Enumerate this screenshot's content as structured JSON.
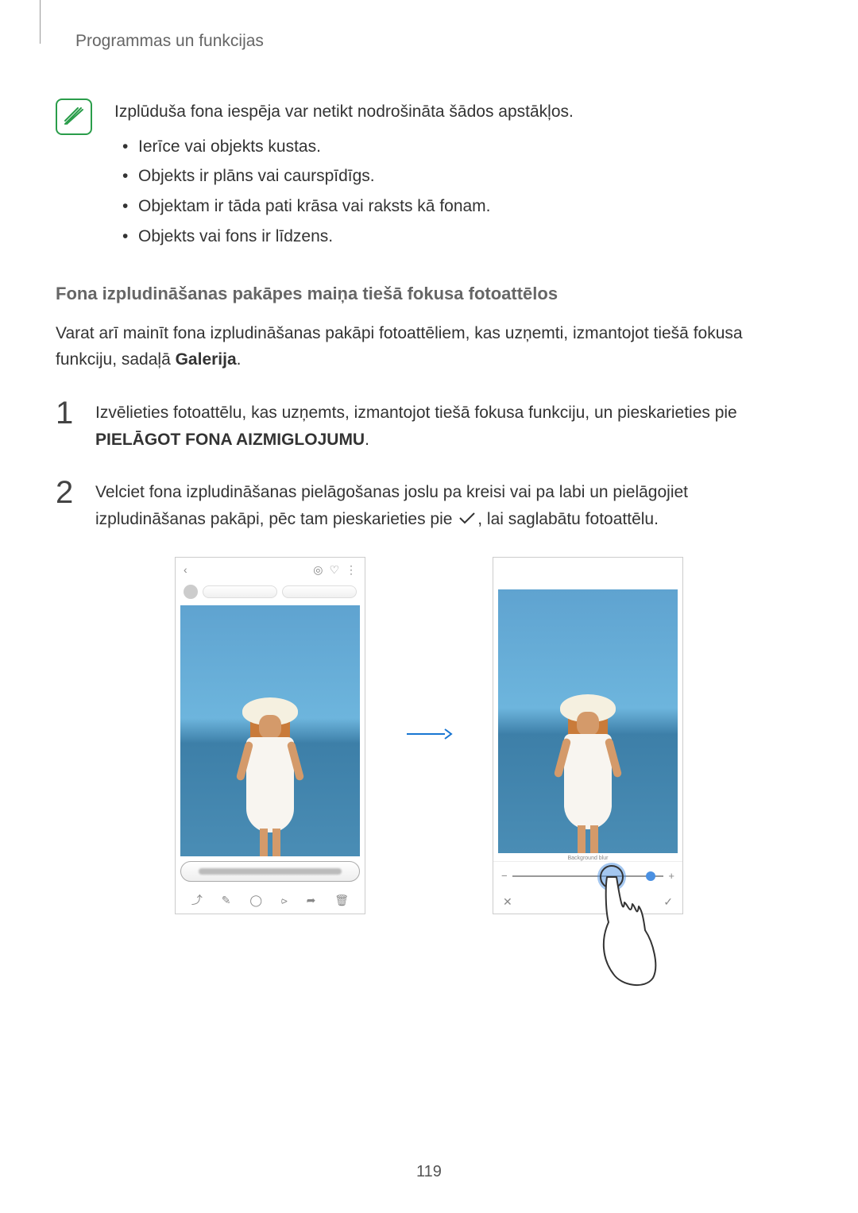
{
  "header": "Programmas un funkcijas",
  "note": {
    "intro": "Izplūduša fona iespēja var netikt nodrošināta šādos apstākļos.",
    "items": [
      "Ierīce vai objekts kustas.",
      "Objekts ir plāns vai caurspīdīgs.",
      "Objektam ir tāda pati krāsa vai raksts kā fonam.",
      "Objekts vai fons ir līdzens."
    ]
  },
  "section_heading": "Fona izpludināšanas pakāpes maiņa tiešā fokusa fotoattēlos",
  "section_body_pre": "Varat arī mainīt fona izpludināšanas pakāpi fotoattēliem, kas uzņemti, izmantojot tiešā fokusa funkciju, sadaļā ",
  "section_body_bold": "Galerija",
  "section_body_post": ".",
  "steps": [
    {
      "num": "1",
      "text_pre": "Izvēlieties fotoattēlu, kas uzņemts, izmantojot tiešā fokusa funkciju, un pieskarieties pie ",
      "text_bold": "PIELĀGOT FONA AIZMIGLOJUMU",
      "text_post": "."
    },
    {
      "num": "2",
      "text_pre": "Velciet fona izpludināšanas pielāgošanas joslu pa kreisi vai pa labi un pielāgojiet izpludināšanas pakāpi, pēc tam pieskarieties pie ",
      "text_post": ", lai saglabātu fotoattēlu."
    }
  ],
  "slider": {
    "minus": "−",
    "plus": "+",
    "label": "Background blur"
  },
  "confirm": {
    "cancel": "✕",
    "ok": "✓"
  },
  "page_number": "119"
}
